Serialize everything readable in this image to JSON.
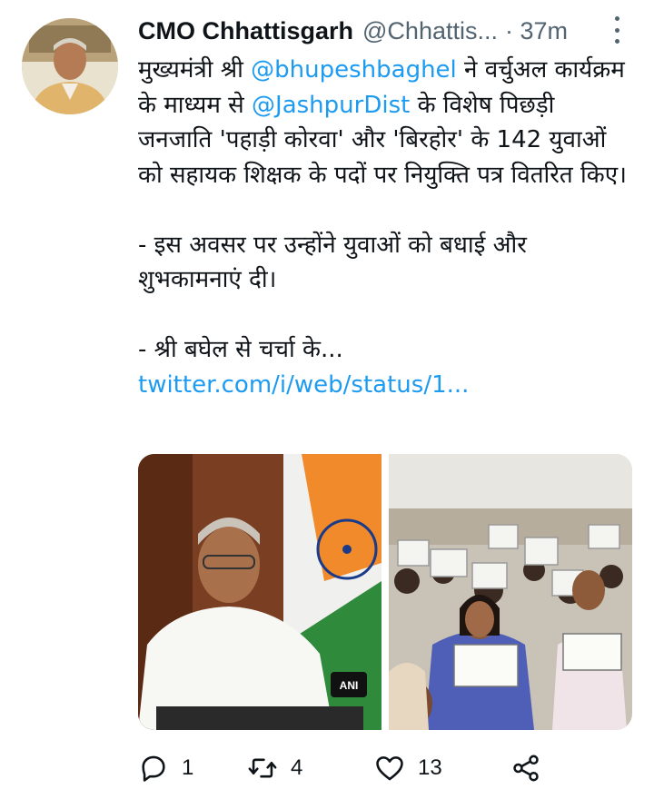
{
  "tweet": {
    "author_name": "CMO Chhattisgarh",
    "handle": "@Chhattis...",
    "time": "· 37m",
    "body": {
      "p1_a": "मुख्यमंत्री श्री ",
      "p1_mention1": "@bhupeshbaghel",
      "p1_b": " ने वर्चुअल कार्यक्रम के माध्यम से ",
      "p1_mention2": "@JashpurDist",
      "p1_c": " के विशेष पिछड़ी जनजाति 'पहाड़ी कोरवा' और 'बिरहोर' के 142 युवाओं को सहायक शिक्षक के पदों पर नियुक्ति पत्र वितरित किए।",
      "p2": "- इस अवसर पर उन्होंने युवाओं को बधाई और शुभकामनाएं दी।",
      "p3_a": "- श्री बघेल से चर्चा के... ",
      "p3_link": "twitter.com/i/web/status/1..."
    },
    "media_badge": "ANI",
    "actions": {
      "reply_count": "1",
      "retweet_count": "4",
      "like_count": "13"
    }
  },
  "colors": {
    "link": "#1d9bf0",
    "secondary_text": "#536471",
    "primary_text": "#0f1419"
  },
  "icons": [
    "reply-icon",
    "retweet-icon",
    "like-icon",
    "share-icon",
    "more-icon"
  ]
}
